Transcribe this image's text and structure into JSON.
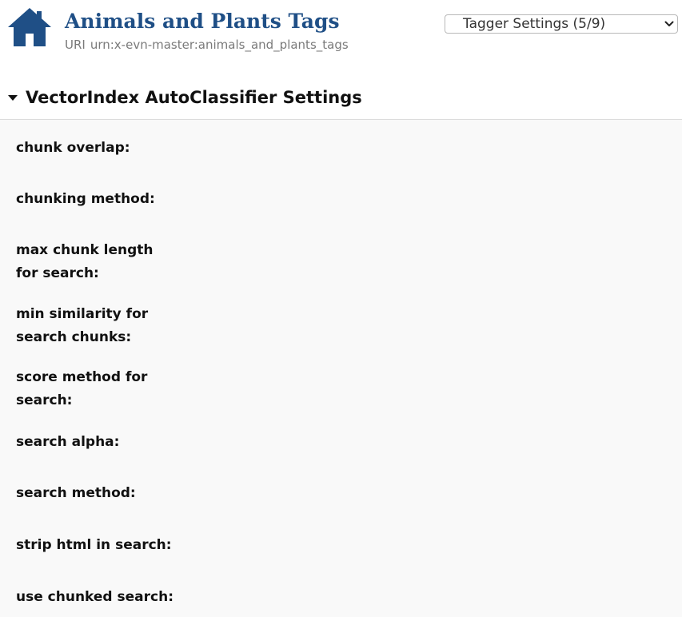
{
  "header": {
    "home_icon": "home-icon",
    "title": "Animals and Plants Tags",
    "uri_label": "URI",
    "uri_value": "urn:x-evn-master:animals_and_plants_tags",
    "brand_color": "#1f4f86"
  },
  "view_select": {
    "selected": "Tagger Settings (5/9)",
    "icon": "chevron-down-icon"
  },
  "section": {
    "caret_icon": "caret-down-icon",
    "title": "VectorIndex AutoClassifier Settings",
    "settings": [
      {
        "label": "chunk overlap:"
      },
      {
        "label": "chunking method:"
      },
      {
        "label": "max chunk length for search:"
      },
      {
        "label": "min similarity for search chunks:"
      },
      {
        "label": "score method for search:"
      },
      {
        "label": "search alpha:"
      },
      {
        "label": "search method:"
      },
      {
        "label": "strip html in search:"
      },
      {
        "label": "use chunked search:"
      }
    ]
  }
}
